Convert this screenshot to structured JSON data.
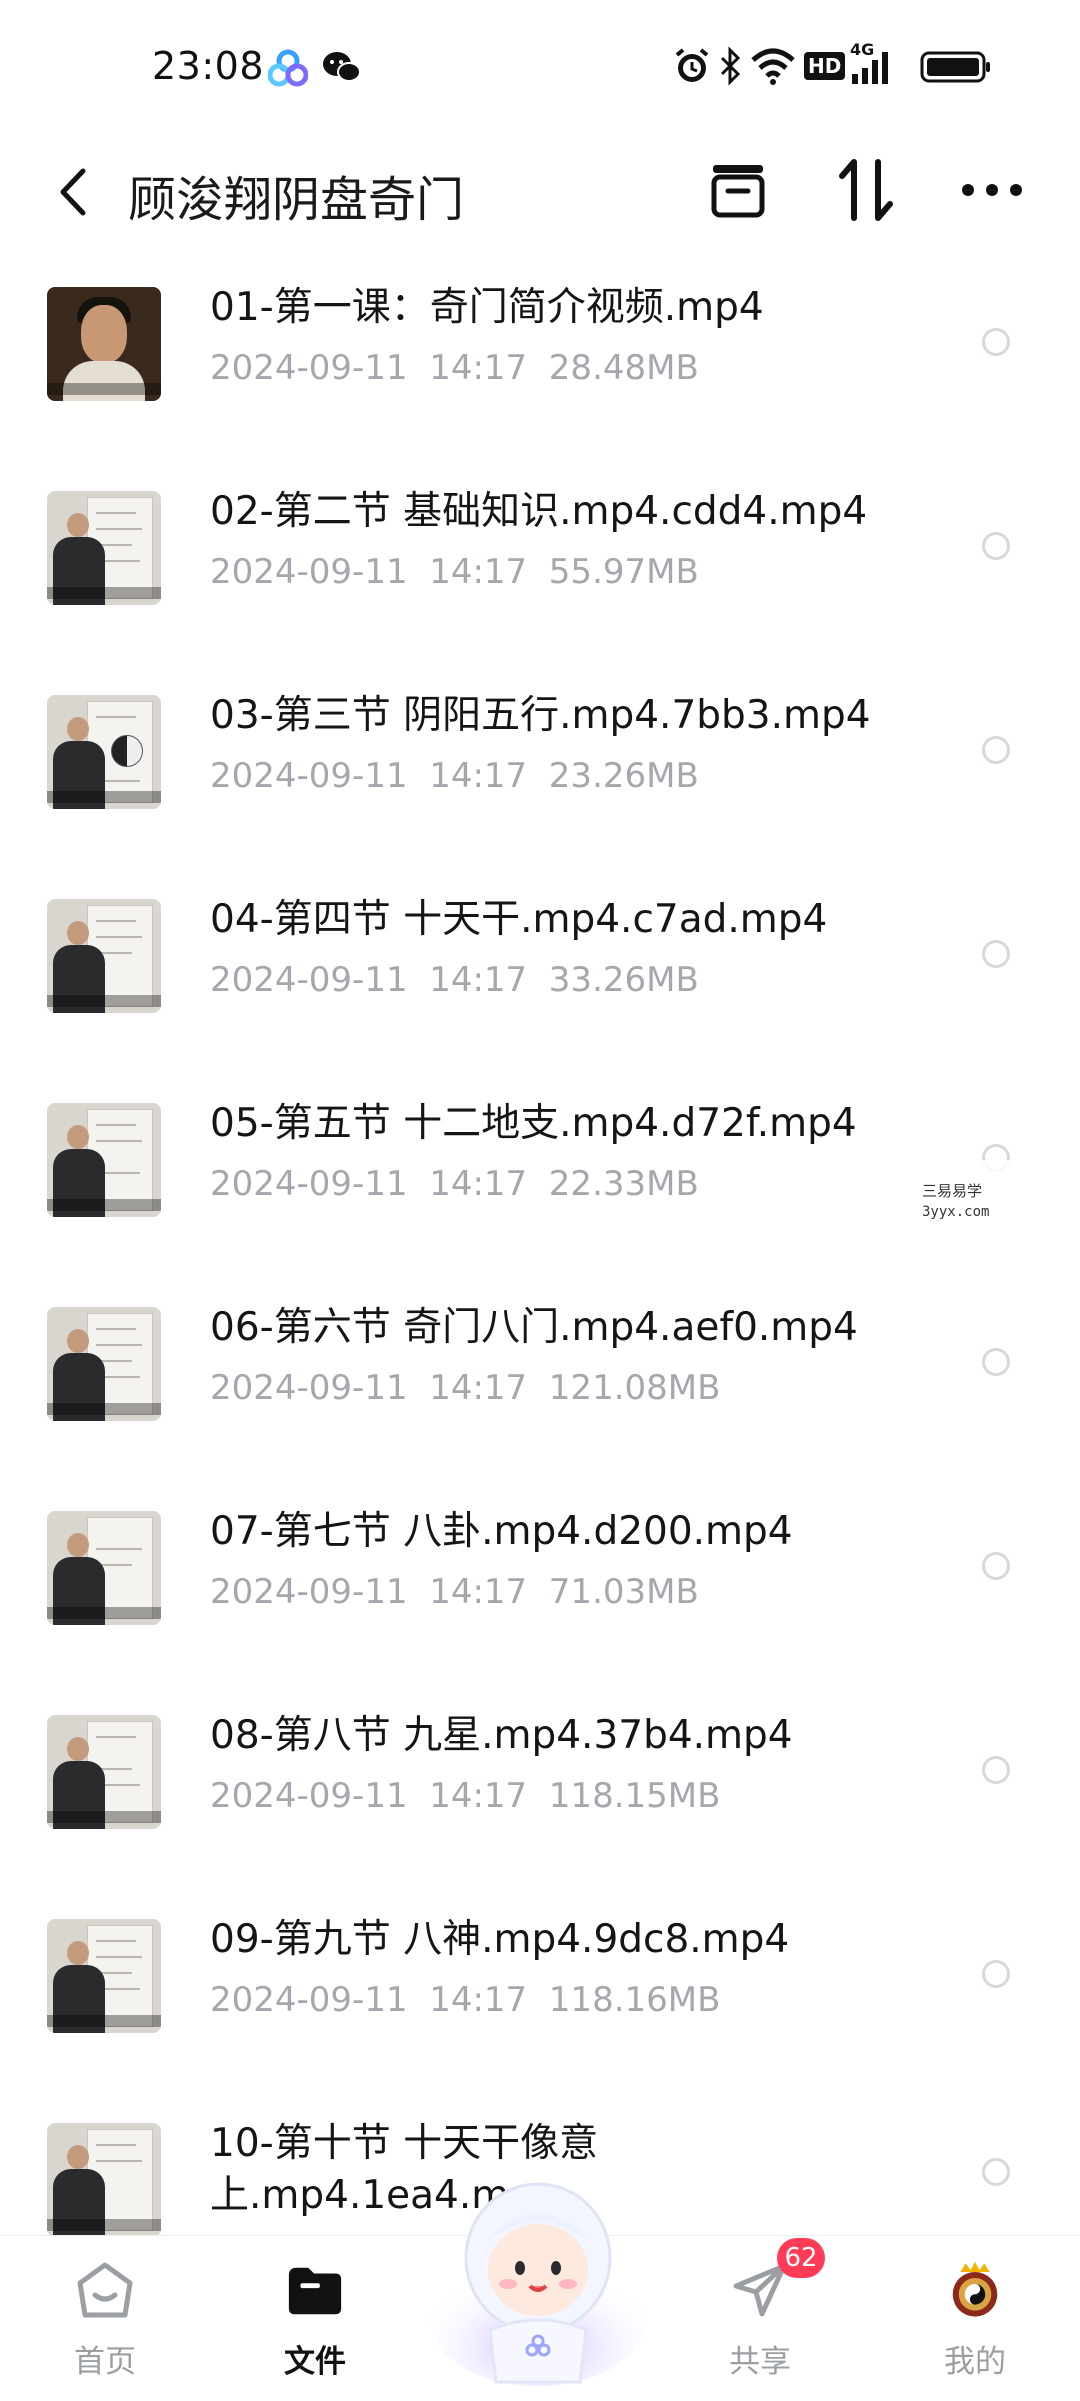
{
  "status_bar": {
    "time": "23:08",
    "icons": [
      "baidu-netdisk-icon",
      "wechat-icon",
      "alarm-icon",
      "bluetooth-icon",
      "wifi-icon",
      "hd-icon",
      "signal-4g-icon",
      "battery-icon"
    ],
    "hd": "HD",
    "network": "4G"
  },
  "header": {
    "title": "顾浚翔阴盘奇门",
    "icons": [
      "back-icon",
      "archive-icon",
      "sort-icon",
      "more-icon"
    ]
  },
  "files": [
    {
      "name": "01-第一课：奇门简介视频.mp4",
      "date": "2024-09-11",
      "time": "14:17",
      "size": "28.48MB"
    },
    {
      "name": "02-第二节 基础知识.mp4.cdd4.mp4",
      "date": "2024-09-11",
      "time": "14:17",
      "size": "55.97MB"
    },
    {
      "name": "03-第三节 阴阳五行.mp4.7bb3.mp4",
      "date": "2024-09-11",
      "time": "14:17",
      "size": "23.26MB"
    },
    {
      "name": "04-第四节 十天干.mp4.c7ad.mp4",
      "date": "2024-09-11",
      "time": "14:17",
      "size": "33.26MB"
    },
    {
      "name": "05-第五节 十二地支.mp4.d72f.mp4",
      "date": "2024-09-11",
      "time": "14:17",
      "size": "22.33MB"
    },
    {
      "name": "06-第六节 奇门八门.mp4.aef0.mp4",
      "date": "2024-09-11",
      "time": "14:17",
      "size": "121.08MB"
    },
    {
      "name": "07-第七节 八卦.mp4.d200.mp4",
      "date": "2024-09-11",
      "time": "14:17",
      "size": "71.03MB"
    },
    {
      "name": "08-第八节 九星.mp4.37b4.mp4",
      "date": "2024-09-11",
      "time": "14:17",
      "size": "118.15MB"
    },
    {
      "name": "09-第九节 八神.mp4.9dc8.mp4",
      "date": "2024-09-11",
      "time": "14:17",
      "size": "118.16MB"
    },
    {
      "name": "10-第十节 十天干像意上.mp4.1ea4.m",
      "date": "",
      "time": "",
      "size": ""
    }
  ],
  "meta_lines": [
    "2024-09-11  14:17  28.48MB",
    "2024-09-11  14:17  55.97MB",
    "2024-09-11  14:17  23.26MB",
    "2024-09-11  14:17  33.26MB",
    "2024-09-11  14:17  22.33MB",
    "2024-09-11  14:17  121.08MB",
    "2024-09-11  14:17  71.03MB",
    "2024-09-11  14:17  118.15MB",
    "2024-09-11  14:17  118.16MB",
    ""
  ],
  "watermark": {
    "line1": "三易易学",
    "line2": "3yyx.com"
  },
  "bottom_nav": {
    "items": [
      {
        "label": "首页",
        "icon": "home-icon",
        "active": false
      },
      {
        "label": "文件",
        "icon": "folder-icon",
        "active": true
      },
      {
        "label": "",
        "icon": "mascot-icon",
        "active": false
      },
      {
        "label": "共享",
        "icon": "share-icon",
        "active": false,
        "badge": "62"
      },
      {
        "label": "我的",
        "icon": "profile-avatar-icon",
        "active": false
      }
    ]
  },
  "colors": {
    "accent": "#111111",
    "meta": "#a4a8ae",
    "badge": "#ff3b55"
  }
}
